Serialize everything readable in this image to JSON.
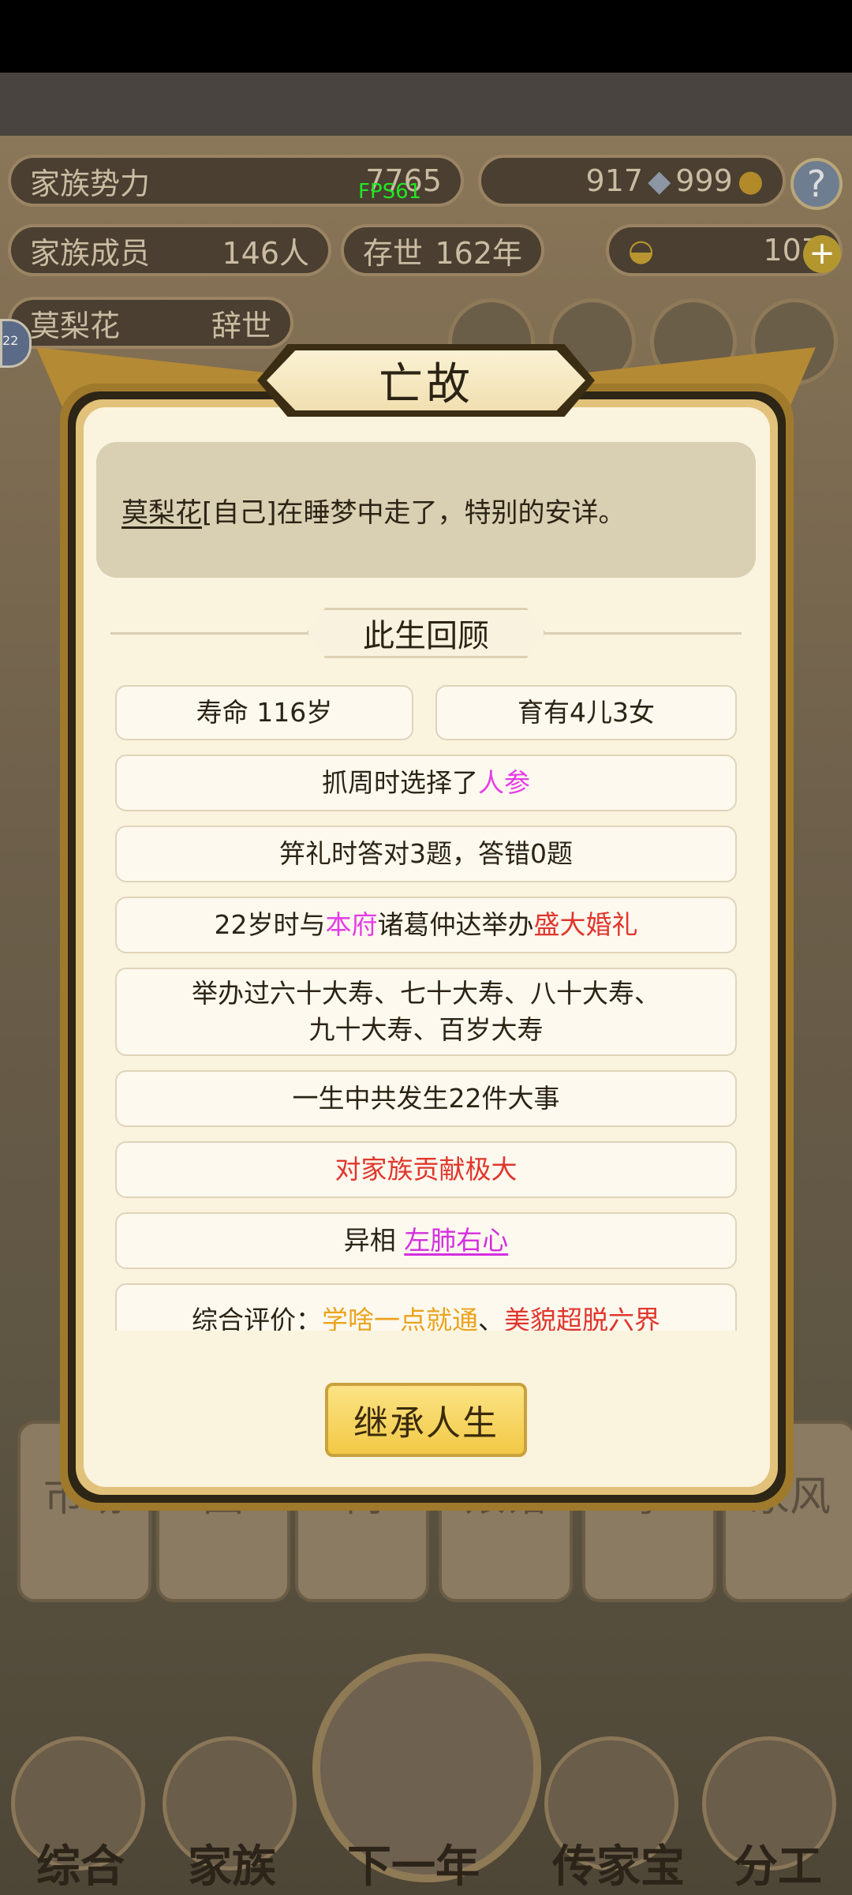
{
  "hud": {
    "family_power_label": "家族势力",
    "family_power_value": "7765",
    "fps": "FPS61",
    "silver": "917",
    "gold": "999",
    "members_label": "家族成员",
    "members_value": "146人",
    "living_label": "存世",
    "living_value": "162年",
    "ingots": "107",
    "deceased_name": "莫梨花",
    "deceased_status": "辞世",
    "avatar_badge": "22"
  },
  "background": {
    "nav_buttons": [
      "市场",
      "园",
      "祠",
      "娘馆",
      "事",
      "家风"
    ],
    "tabs": [
      "综合",
      "家族",
      "下一年",
      "传家宝",
      "分工"
    ]
  },
  "modal": {
    "title": "亡故",
    "message_name": "莫梨花",
    "message_rest": "[自己]在睡梦中走了，特别的安详。",
    "section_title": "此生回顾",
    "lifespan": "寿命 116岁",
    "children": "育有4儿3女",
    "zhuazhou_prefix": "抓周时选择了",
    "zhuazhou_item": "人参",
    "ji_li": "笄礼时答对3题，答错0题",
    "marriage_prefix": "22岁时与",
    "marriage_house": "本府",
    "marriage_mid": "诸葛仲达举办",
    "marriage_type": "盛大婚礼",
    "birthdays_line1": "举办过六十大寿、七十大寿、八十大寿、",
    "birthdays_line2": "九十大寿、百岁大寿",
    "events": "一生中共发生22件大事",
    "contribution": "对家族贡献极大",
    "trait_label": "异相",
    "trait_value": "左肺右心",
    "rating_label": "综合评价：",
    "rating_1": "学啥一点就通",
    "rating_sep": "、",
    "rating_2": "美貌超脱六界",
    "inherit_button": "继承人生"
  },
  "colors": {
    "accent_gold": "#f2c946",
    "highlight_magenta": "#e43de6",
    "highlight_red": "#e0362e",
    "highlight_orange": "#eba31d"
  }
}
